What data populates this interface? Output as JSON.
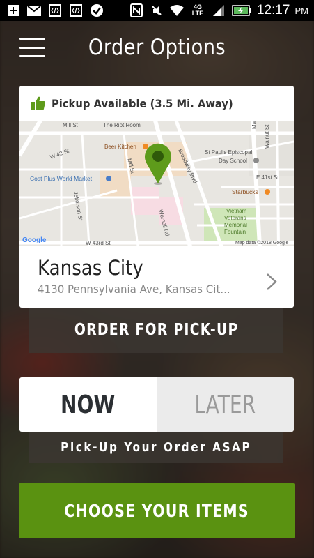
{
  "colors": {
    "accent_green": "#5a9211",
    "pin_green": "#5e9b1b",
    "card_bg": "#ffffff",
    "status_bar_bg": "#000000"
  },
  "status_bar": {
    "left_icons": [
      "plus-icon",
      "gmail-icon",
      "code-icon",
      "code-icon",
      "check-badge-icon"
    ],
    "right_icons": [
      "nfc-icon",
      "mute-icon",
      "wifi-icon",
      "4g-lte-icon",
      "signal-icon",
      "battery-charging-icon"
    ],
    "network_label": "4G LTE",
    "time": "12:17",
    "ampm": "PM"
  },
  "header": {
    "menu_icon": "hamburger-menu-icon",
    "title": "Order Options"
  },
  "location_card": {
    "availability": "Pickup Available (3.5 Mi. Away)",
    "availability_icon": "thumbs-up-icon",
    "map": {
      "labels": {
        "mill_st": "Mill St",
        "riot_room": "The Riot Room",
        "main_st": "Main St",
        "beer_kitchen": "Beer Kitchen",
        "w42": "W 42 St",
        "mill_st_v": "Mill St",
        "broadway": "Broadway Blvd",
        "st_pauls": "St Paul's Episcopal",
        "day_school": "Day School",
        "walnut": "Walnut St",
        "cost_plus": "Cost Plus World Market",
        "e41": "E 41st St",
        "jefferson": "Jefferson St",
        "starbucks": "Starbucks",
        "wornall": "Wornall Rd",
        "vietnam": "Vietnam",
        "veterans": "Veterans",
        "memorial": "Memorial",
        "fountain": "Fountain",
        "w43": "W 43rd St",
        "google": "Google",
        "copyright": "Map data ©2018 Google"
      }
    },
    "name": "Kansas City",
    "address": "4130 Pennsylvania Ave, Kansas Cit..."
  },
  "order_type_button": "ORDER FOR PICK-UP",
  "timing": {
    "now": "NOW",
    "later": "LATER",
    "selected": "NOW"
  },
  "asap_text": "Pick-Up Your Order ASAP",
  "cta_button": "CHOOSE YOUR ITEMS"
}
